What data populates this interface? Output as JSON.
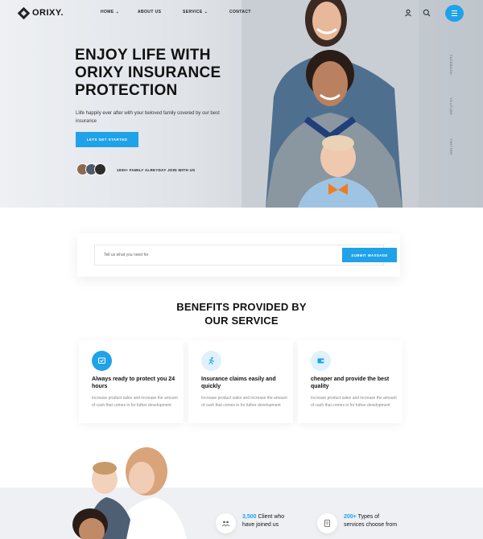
{
  "brand": {
    "name": "ORIXY."
  },
  "nav": {
    "items": [
      {
        "label": "HOME",
        "has_dropdown": true
      },
      {
        "label": "ABOUT US",
        "has_dropdown": false
      },
      {
        "label": "SERVICE",
        "has_dropdown": true
      },
      {
        "label": "CONTACT",
        "has_dropdown": false
      }
    ],
    "icons": [
      "user-icon",
      "search-icon",
      "menu-icon"
    ]
  },
  "hero": {
    "title_lines": [
      "ENJOY LIFE WITH",
      "ORIXY INSURANCE",
      "PROTECTION"
    ],
    "subtitle": "Llife happily ever after with your beloved family covered by our best insurance",
    "cta_label": "LETS GET STARTED",
    "join_text": "1000+ FAMILY ALREYDAY JOIN WITH US"
  },
  "social": [
    "FACEBOOK",
    "YOUTUBE",
    "TWITTER"
  ],
  "search": {
    "placeholder": "Tell us what you need for",
    "button_label": "SUBMIT MASSAGE"
  },
  "benefits": {
    "title_lines": [
      "BENEFITS PROVIDED BY",
      "OUR SERVICE"
    ],
    "cards": [
      {
        "icon": "support-icon",
        "title": "Always ready to protect you 24 hours",
        "body": "Increase product sales and increase the amount of cash that comes in for futher development"
      },
      {
        "icon": "running-person-icon",
        "title": "Insurance claims easily and quickly",
        "body": "Increase product sales and increase the amount of cash that comes in for futher development"
      },
      {
        "icon": "wallet-icon",
        "title": "cheaper and provide the best quality",
        "body": "Increase product sales and increase the amount of cash that comes in for futher development"
      }
    ]
  },
  "stats": [
    {
      "icon": "users-icon",
      "number": "3,500",
      "label_line1": " Client who",
      "label_line2": "have joined us"
    },
    {
      "icon": "document-icon",
      "number": "200+",
      "label_line1": " Types of",
      "label_line2": "services choose from"
    }
  ],
  "colors": {
    "accent": "#1fa2e8",
    "text": "#111111",
    "muted": "#888888"
  }
}
